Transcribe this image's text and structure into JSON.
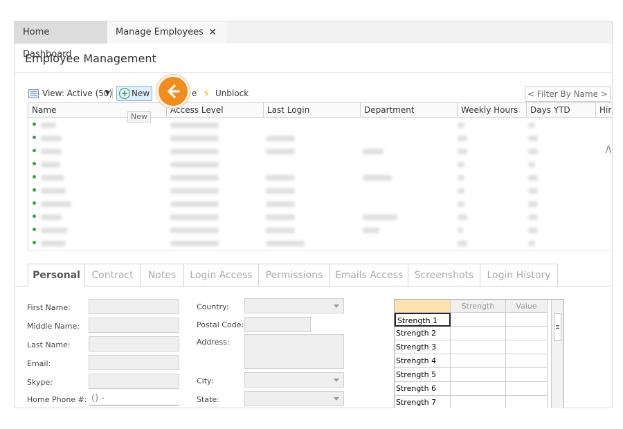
{
  "tabs": [
    {
      "label": "Home Dashboard"
    },
    {
      "label": "Manage Employees",
      "close_icon": "close-icon"
    }
  ],
  "page_title": "Employee Management",
  "toolbar": {
    "view_label": "View: Active (50)",
    "new_label": "New",
    "archive_fragment": "e",
    "unblock_label": "Unblock",
    "filter_placeholder": "< Filter By Name >"
  },
  "overlay": {
    "arrow_icon": "arrow-left-icon",
    "color": "#f28c1d"
  },
  "tooltip": "New",
  "grid": {
    "columns": [
      "Name",
      "Access Level",
      "Last Login",
      "Department",
      "Weekly Hours",
      "Days YTD",
      "Hir"
    ],
    "row_count": 10,
    "row_fragment": "/\\",
    "status_color": "#3aa53a"
  },
  "detail_tabs": [
    "Personal",
    "Contract",
    "Notes",
    "Login Access",
    "Permissions",
    "Emails Access",
    "Screenshots",
    "Login History"
  ],
  "form": {
    "first_name": "First Name:",
    "middle_name": "Middle Name:",
    "last_name": "Last Name:",
    "email": "Email:",
    "skype": "Skype:",
    "home_phone": "Home Phone #:",
    "home_phone_value": "() -",
    "country": "Country:",
    "postal_code": "Postal Code:",
    "address": "Address:",
    "city": "City:",
    "state": "State:"
  },
  "strength_grid": {
    "headers": [
      "Strength",
      "Value"
    ],
    "rows": [
      "Strength 1",
      "Strength 2",
      "Strength 3",
      "Strength 4",
      "Strength 5",
      "Strength 6",
      "Strength 7"
    ]
  }
}
